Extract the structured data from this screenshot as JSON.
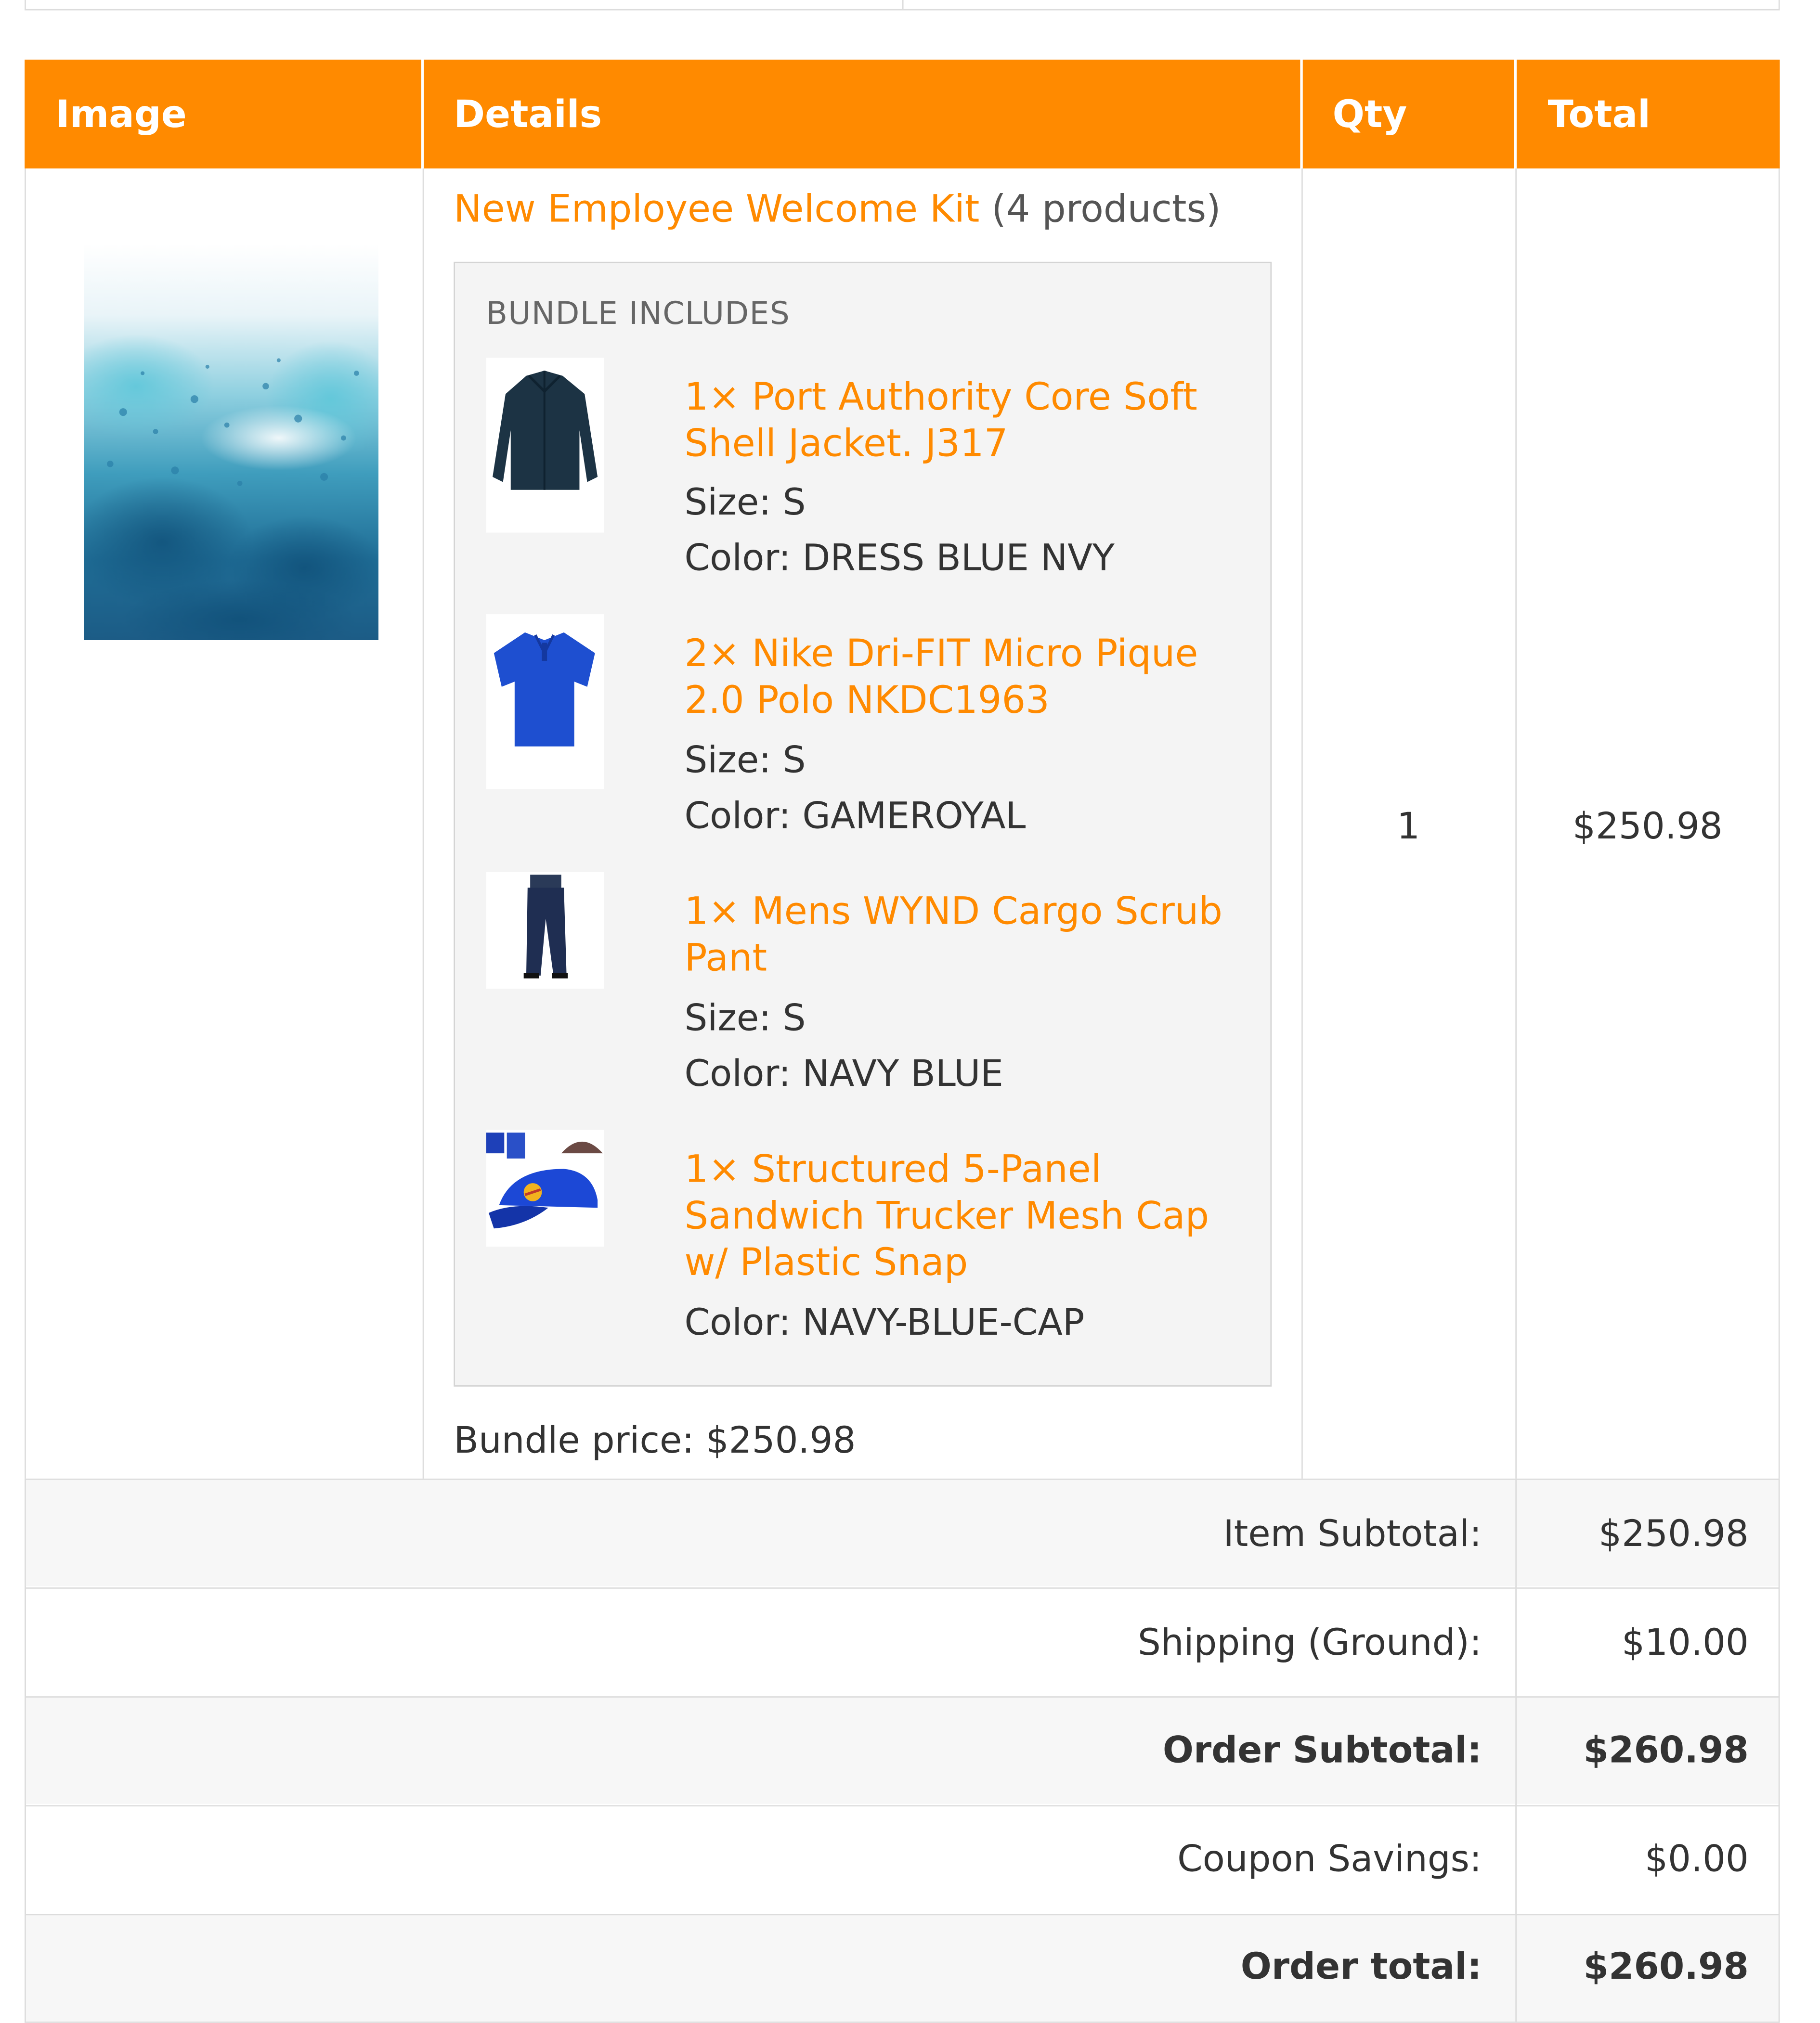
{
  "table": {
    "headers": {
      "image": "Image",
      "details": "Details",
      "qty": "Qty",
      "total": "Total"
    },
    "accent_color": "#ff8a00"
  },
  "bundle": {
    "name": "New Employee Welcome Kit",
    "count": "(4 products)",
    "caption": "BUNDLE INCLUDES",
    "items": [
      {
        "name": "1× Port Authority Core Soft Shell Jacket. J317",
        "size": "Size: S",
        "color": "Color: DRESS BLUE NVY",
        "icon": "jacket-icon"
      },
      {
        "name": "2× Nike Dri-FIT Micro Pique 2.0 Polo NKDC1963",
        "size": "Size: S",
        "color": "Color: GAMEROYAL",
        "icon": "polo-shirt-icon"
      },
      {
        "name": "1× Mens WYND Cargo Scrub Pant",
        "size": "Size: S",
        "color": "Color: NAVY BLUE",
        "icon": "pants-icon"
      },
      {
        "name": "1× Structured 5-Panel Sandwich Trucker Mesh Cap w/ Plastic Snap",
        "color": "Color: NAVY-BLUE-CAP",
        "icon": "cap-icon"
      }
    ],
    "price": "Bundle price: $250.98",
    "qty": "1",
    "total": "$250.98"
  },
  "summary": [
    {
      "label": "Item Subtotal:",
      "value": "$250.98",
      "bold": false
    },
    {
      "label": "Shipping (Ground):",
      "value": "$10.00",
      "bold": false
    },
    {
      "label": "Order Subtotal:",
      "value": "$260.98",
      "bold": true
    },
    {
      "label": "Coupon Savings:",
      "value": "$0.00",
      "bold": false
    },
    {
      "label": "Order total:",
      "value": "$260.98",
      "bold": true
    }
  ]
}
